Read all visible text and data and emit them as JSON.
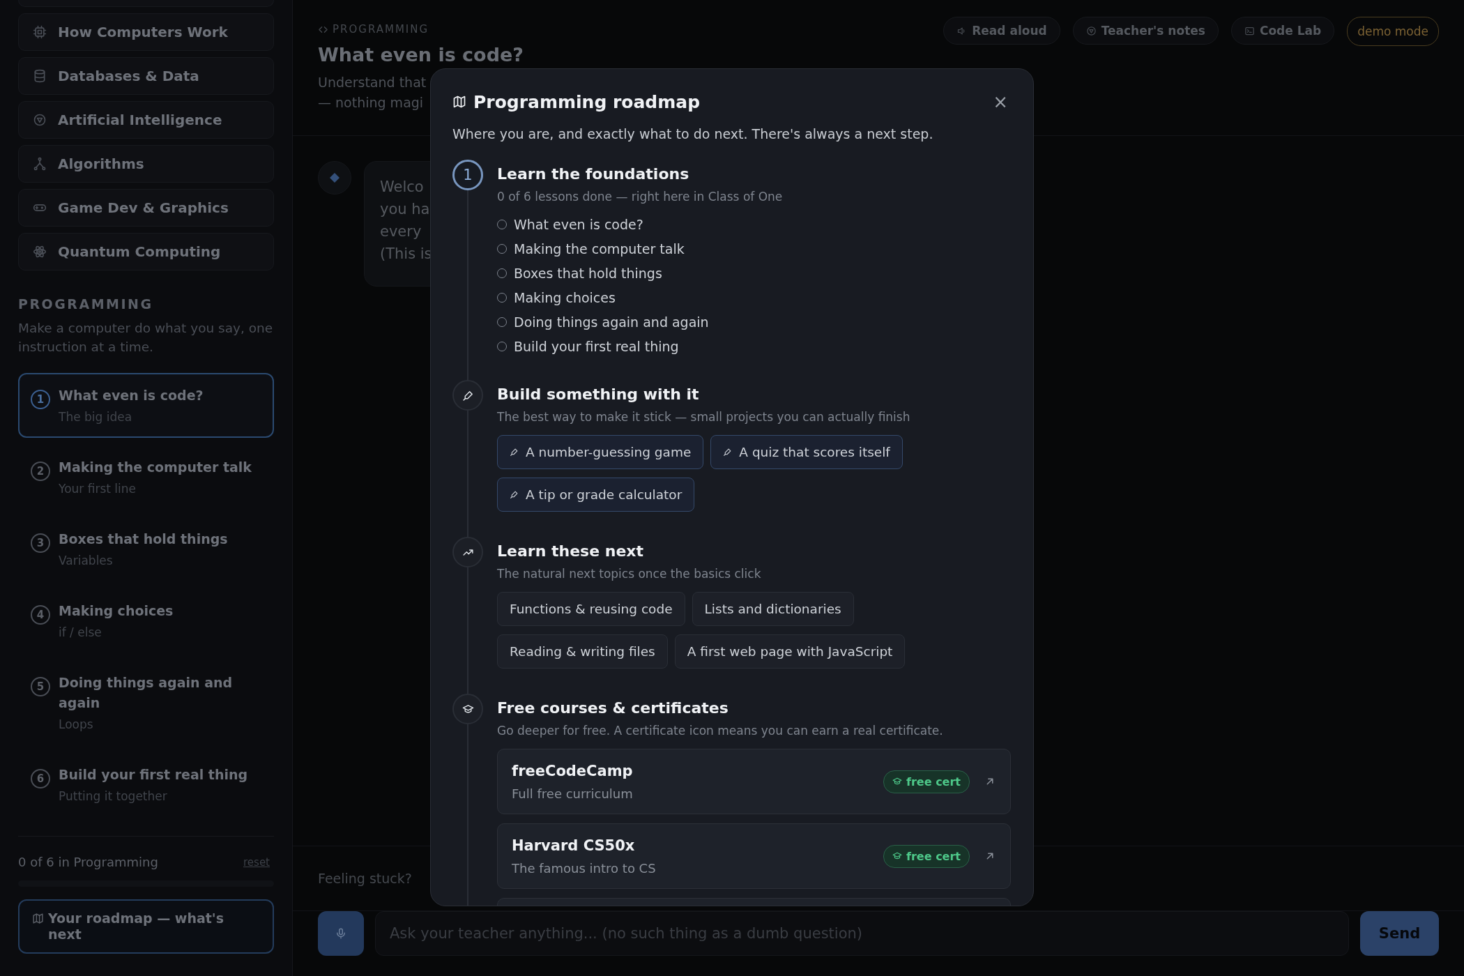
{
  "sidebar": {
    "topics": [
      {
        "label": "How Computers Work"
      },
      {
        "label": "Databases & Data"
      },
      {
        "label": "Artificial Intelligence"
      },
      {
        "label": "Algorithms"
      },
      {
        "label": "Game Dev & Graphics"
      },
      {
        "label": "Quantum Computing"
      }
    ],
    "section": {
      "title": "PROGRAMMING",
      "description": "Make a computer do what you say, one instruction at a time."
    },
    "lessons": [
      {
        "number": "1",
        "title": "What even is code?",
        "subtitle": "The big idea",
        "selected": true
      },
      {
        "number": "2",
        "title": "Making the computer talk",
        "subtitle": "Your first line",
        "selected": false
      },
      {
        "number": "3",
        "title": "Boxes that hold things",
        "subtitle": "Variables",
        "selected": false
      },
      {
        "number": "4",
        "title": "Making choices",
        "subtitle": "if / else",
        "selected": false
      },
      {
        "number": "5",
        "title": "Doing things again and again",
        "subtitle": "Loops",
        "selected": false
      },
      {
        "number": "6",
        "title": "Build your first real thing",
        "subtitle": "Putting it together",
        "selected": false
      }
    ],
    "progress": {
      "label": "0 of 6 in Programming",
      "reset": "reset",
      "level": 0
    },
    "roadmap_button": "Your roadmap — what's next"
  },
  "header": {
    "breadcrumb": "PROGRAMMING",
    "title": "What even is code?",
    "subtitle_lines": [
      "Understand that",
      "— nothing magi"
    ],
    "actions": [
      {
        "label": "Read aloud"
      },
      {
        "label": "Teacher's notes"
      },
      {
        "label": "Code Lab"
      }
    ],
    "badge": "demo mode"
  },
  "chat": {
    "message_lines": [
      "Welco",
      "you ha",
      "every",
      "(This is"
    ]
  },
  "stuck": {
    "label": "Feeling stuck?"
  },
  "composer": {
    "placeholder": "Ask your teacher anything... (no such thing as a dumb question)",
    "send": "Send"
  },
  "modal": {
    "title": "Programming roadmap",
    "close": "×",
    "description": "Where you are, and exactly what to do next. There's always a next step.",
    "steps": [
      {
        "kind": "lessons",
        "marker": "1",
        "current": true,
        "title": "Learn the foundations",
        "subtitle": "0 of 6 lessons done — right here in Class of One",
        "items": [
          {
            "label": "What even is code?",
            "done": false
          },
          {
            "label": "Making the computer talk",
            "done": false
          },
          {
            "label": "Boxes that hold things",
            "done": false
          },
          {
            "label": "Making choices",
            "done": false
          },
          {
            "label": "Doing things again and again",
            "done": false
          },
          {
            "label": "Build your first real thing",
            "done": false
          }
        ]
      },
      {
        "kind": "projects",
        "current": false,
        "title": "Build something with it",
        "subtitle": "The best way to make it stick — small projects you can actually finish",
        "items": [
          {
            "label": "A number-guessing game"
          },
          {
            "label": "A quiz that scores itself"
          },
          {
            "label": "A tip or grade calculator"
          }
        ]
      },
      {
        "kind": "topics",
        "current": false,
        "title": "Learn these next",
        "subtitle": "The natural next topics once the basics click",
        "items": [
          {
            "label": "Functions & reusing code"
          },
          {
            "label": "Lists and dictionaries"
          },
          {
            "label": "Reading & writing files"
          },
          {
            "label": "A first web page with JavaScript"
          }
        ]
      },
      {
        "kind": "courses",
        "current": false,
        "title": "Free courses & certificates",
        "subtitle": "Go deeper for free. A certificate icon means you can earn a real certificate.",
        "items": [
          {
            "name": "freeCodeCamp",
            "description": "Full free curriculum",
            "badge": "free cert"
          },
          {
            "name": "Harvard CS50x",
            "description": "The famous intro to CS",
            "badge": "free cert"
          }
        ]
      }
    ]
  }
}
